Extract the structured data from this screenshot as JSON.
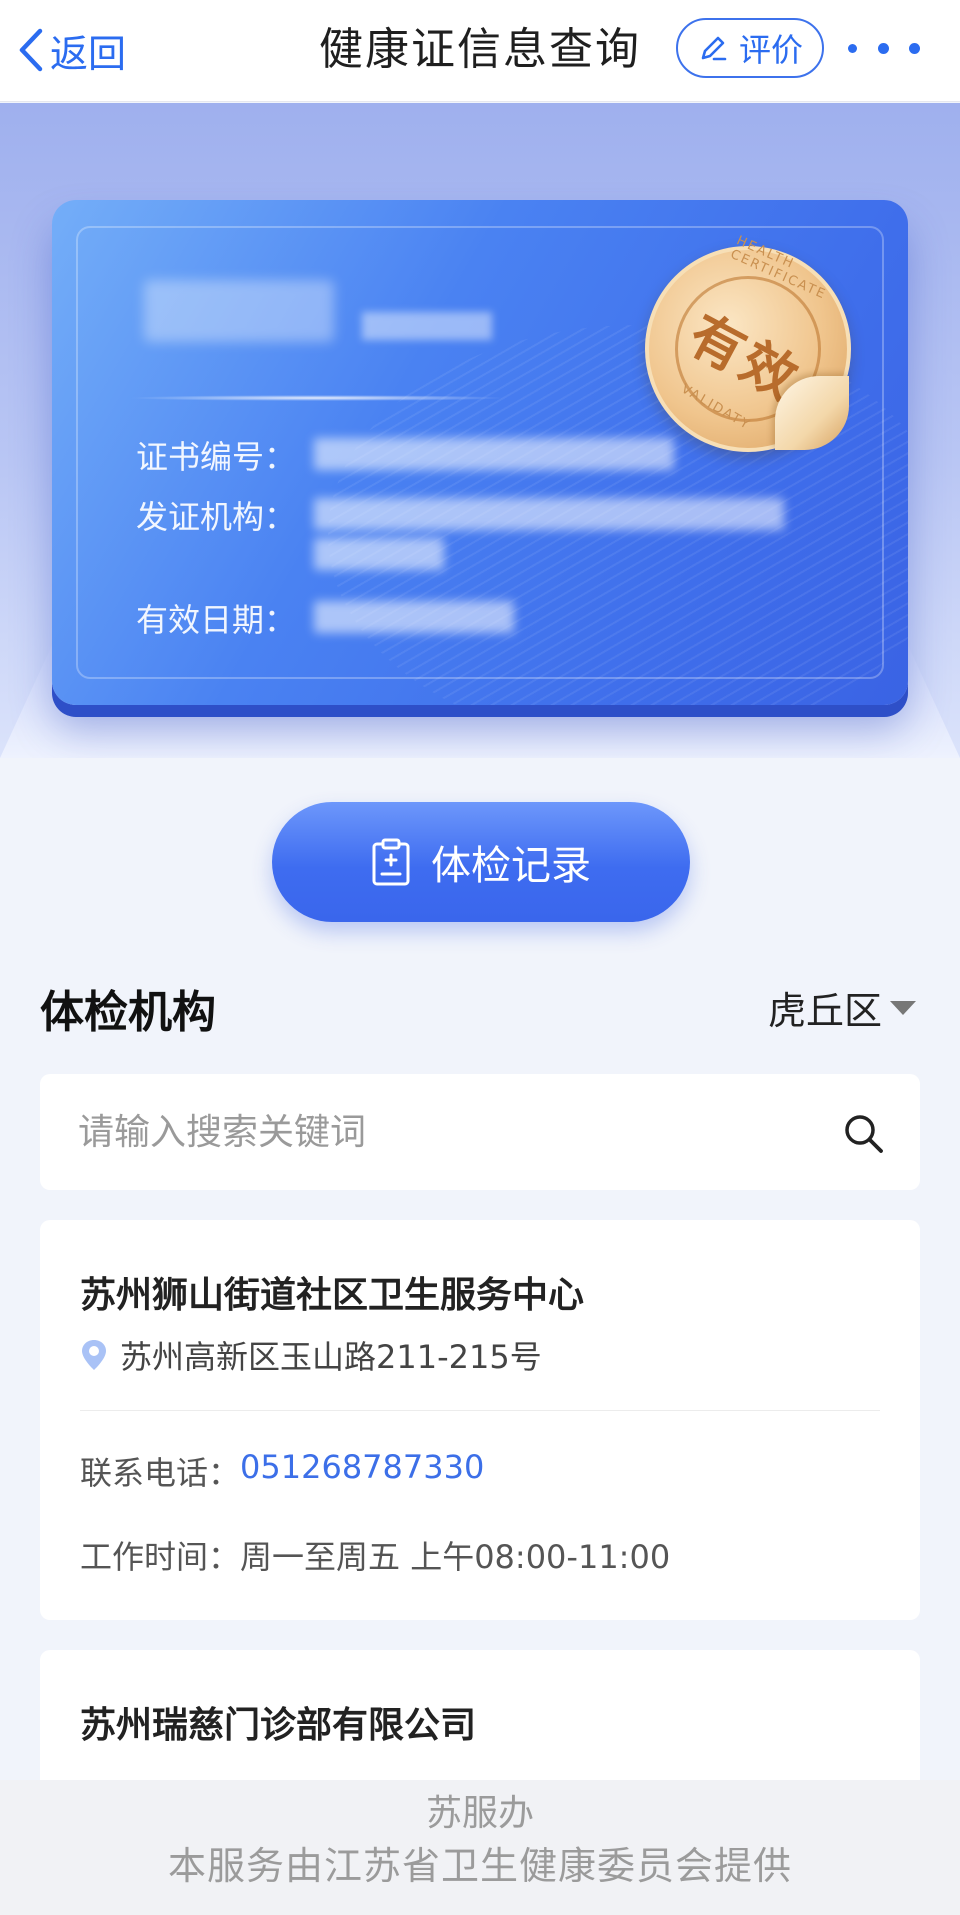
{
  "nav": {
    "back_label": "返回",
    "title": "健康证信息查询",
    "rate_label": "评价"
  },
  "card": {
    "stamp_text": "有效",
    "stamp_ring_top": "HEALTH CERTIFICATE",
    "stamp_ring_bottom": "VALIDATY",
    "cert_no_label": "证书编号：",
    "issuer_label": "发证机构：",
    "valid_date_label": "有效日期："
  },
  "record_button": {
    "label": "体检记录"
  },
  "section": {
    "title": "体检机构",
    "district": "虎丘区"
  },
  "search": {
    "placeholder": "请输入搜索关键词"
  },
  "institutions": [
    {
      "name": "苏州狮山街道社区卫生服务中心",
      "address": "苏州高新区玉山路211-215号",
      "phone_label": "联系电话：",
      "phone": "051268787330",
      "hours_label": "工作时间：",
      "hours": "周一至周五 上午08:00-11:00"
    },
    {
      "name": "苏州瑞慈门诊部有限公司"
    }
  ],
  "footer": {
    "brand": "苏服办",
    "provider": "本服务由江苏省卫生健康委员会提供"
  },
  "colors": {
    "accent": "#2b6cf0",
    "card_blue": "#4a82f2",
    "stamp_gold": "#f0c58d",
    "link_blue": "#3c6fe8"
  }
}
